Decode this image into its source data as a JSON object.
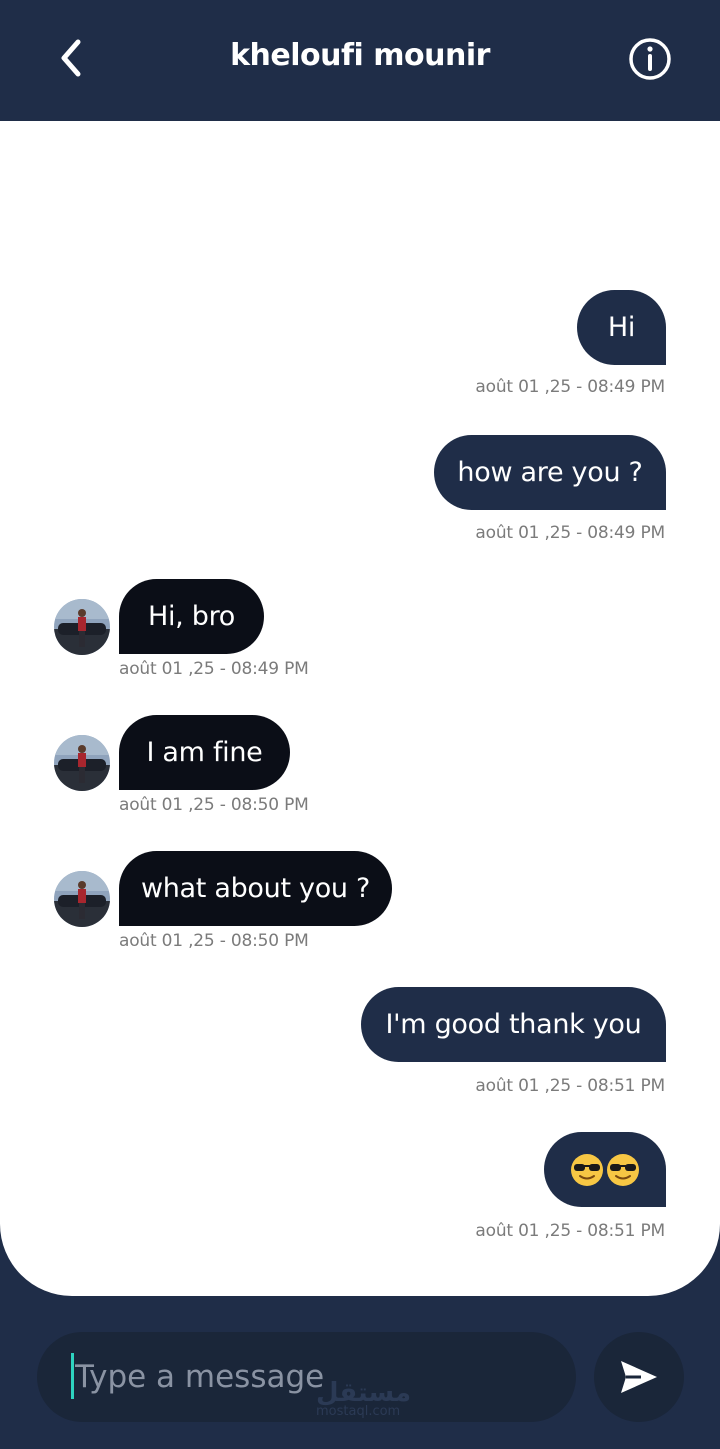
{
  "header": {
    "title": "kheloufi mounir",
    "back_icon": "chevron-left-icon",
    "info_icon": "info-circle-icon"
  },
  "messages": [
    {
      "direction": "out",
      "text": "Hi",
      "time": "août 01 ,25 - 08:49 PM"
    },
    {
      "direction": "out",
      "text": "how are you ?",
      "time": "août 01 ,25 - 08:49 PM"
    },
    {
      "direction": "in",
      "text": "Hi, bro",
      "time": "août 01 ,25 - 08:49 PM"
    },
    {
      "direction": "in",
      "text": "I am fine",
      "time": "août 01 ,25 - 08:50 PM"
    },
    {
      "direction": "in",
      "text": "what about you ?",
      "time": "août 01 ,25 - 08:50 PM"
    },
    {
      "direction": "out",
      "text": "I'm good thank you",
      "time": "août 01 ,25 - 08:51 PM"
    },
    {
      "direction": "out",
      "text": "😎😎",
      "time": "août 01 ,25 - 08:51 PM"
    }
  ],
  "composer": {
    "placeholder": "Type a message",
    "send_icon": "send-icon"
  },
  "watermark": {
    "arabic": "مستقل",
    "latin": "mostaql.com"
  },
  "colors": {
    "primary": "#1f2d48",
    "incoming_bubble": "#0b0e17",
    "timestamp": "#7b7b7b",
    "cursor": "#2ed3c0"
  }
}
